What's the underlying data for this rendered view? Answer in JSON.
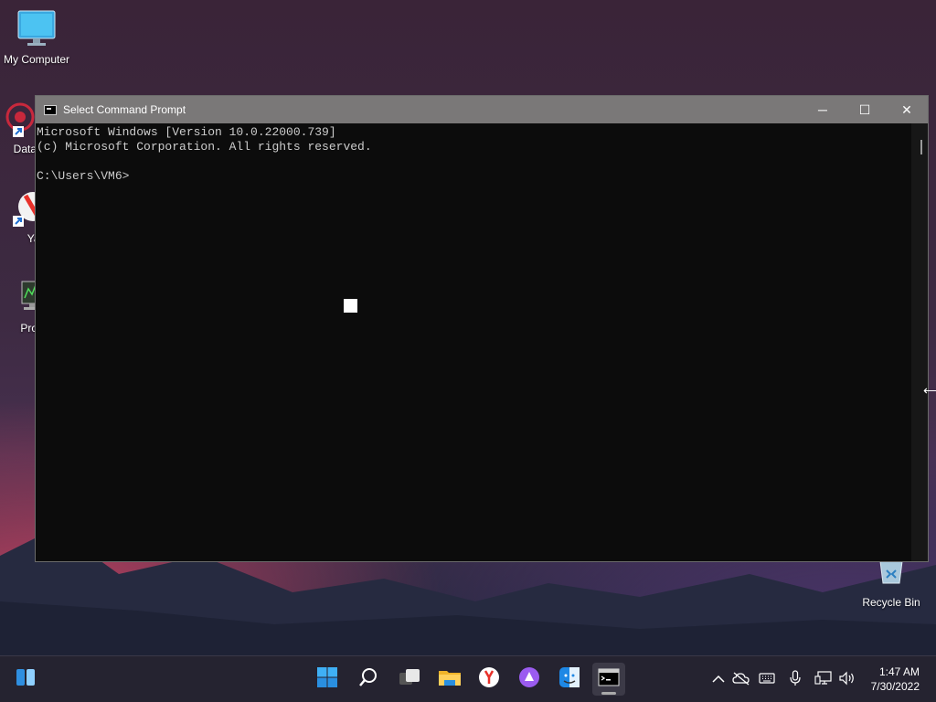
{
  "desktop": {
    "icons": [
      {
        "label": "My Computer",
        "icon": "monitor-icon"
      },
      {
        "label": "DataW",
        "icon": "datawrapper-icon"
      },
      {
        "label": "Yan",
        "icon": "yandex-icon"
      },
      {
        "label": "Proces",
        "icon": "process-icon"
      },
      {
        "label": "Recycle Bin",
        "icon": "recycle-bin-icon"
      }
    ]
  },
  "window": {
    "title": "Select Command Prompt",
    "controls": {
      "minimize": "─",
      "maximize": "☐",
      "close": "✕"
    },
    "console": {
      "lines": [
        "Microsoft Windows [Version 10.0.22000.739]",
        "(c) Microsoft Corporation. All rights reserved.",
        "",
        "C:\\Users\\VM6>"
      ]
    }
  },
  "taskbar": {
    "apps": [
      {
        "name": "widgets",
        "icon": "widgets-icon"
      },
      {
        "name": "start",
        "icon": "windows-start-icon"
      },
      {
        "name": "search",
        "icon": "search-icon"
      },
      {
        "name": "task-view",
        "icon": "task-view-icon"
      },
      {
        "name": "file-explorer",
        "icon": "folder-icon"
      },
      {
        "name": "yandex-browser",
        "icon": "yandex-icon"
      },
      {
        "name": "alice",
        "icon": "alice-icon"
      },
      {
        "name": "finder",
        "icon": "finder-icon"
      },
      {
        "name": "command-prompt",
        "icon": "terminal-icon",
        "active": true
      }
    ],
    "tray": {
      "icons": [
        "chevron-up-icon",
        "cloud-off-icon",
        "keyboard-icon",
        "microphone-icon",
        "network-icon",
        "volume-icon"
      ],
      "time": "1:47 AM",
      "date": "7/30/2022"
    }
  },
  "colors": {
    "titlebar": "#7a7878",
    "console_bg": "#0c0c0c",
    "console_text": "#cccccc",
    "taskbar": "#252330"
  }
}
